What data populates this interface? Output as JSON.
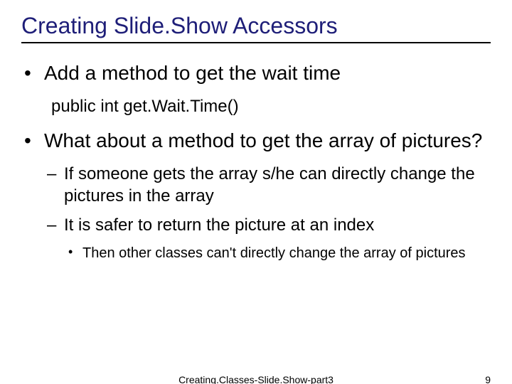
{
  "title": "Creating Slide.Show Accessors",
  "bullets": {
    "b1": "Add a method to get the wait time",
    "b1_code": "public int get.Wait.Time()",
    "b2": "What about a method to get the array of pictures?",
    "b2_sub1": "If someone gets the array s/he can directly change the pictures in the array",
    "b2_sub2": "It is safer to return the picture at an index",
    "b2_sub2_sub1": "Then other classes can't directly change the array of pictures"
  },
  "footer": {
    "center": "Creating.Classes-Slide.Show-part3",
    "page": "9"
  }
}
